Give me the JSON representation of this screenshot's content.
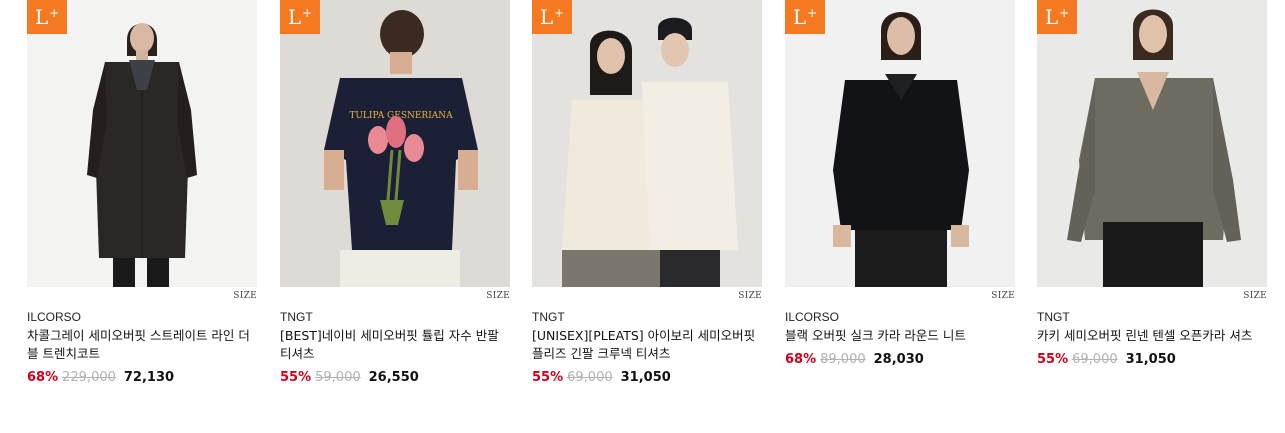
{
  "products": [
    {
      "badge_main": "L",
      "badge_sup": "+",
      "image_icon": "model-photo-long-trench-coat",
      "size_label": "SIZE",
      "brand": "ILCORSO",
      "name": "차콜그레이 세미오버핏 스트레이트 라인 더블 트렌치코트",
      "discount": "68%",
      "original_price": "229,000",
      "sale_price": "72,130",
      "colors": {
        "bg": "#f3f3f1",
        "garment": "#2b2724",
        "inner": "#3c4148",
        "pants": "#1a1a1a"
      }
    },
    {
      "badge_main": "L",
      "badge_sup": "+",
      "image_icon": "model-photo-tshirt-back-tulip-print",
      "size_label": "SIZE",
      "brand": "TNGT",
      "name": "[BEST]네이비 세미오버핏 튤립 자수 반팔 티셔츠",
      "discount": "55%",
      "original_price": "59,000",
      "sale_price": "26,550",
      "colors": {
        "bg": "#dedad6",
        "garment": "#1b2036",
        "print": "#e9b23c",
        "flower": "#e98b95",
        "pants": "#efece3"
      }
    },
    {
      "badge_main": "L",
      "badge_sup": "+",
      "image_icon": "two-models-ivory-longsleeve",
      "size_label": "SIZE",
      "brand": "TNGT",
      "name": "[UNISEX][PLEATS] 아이보리 세미오버핏 플리즈 긴팔 크루넥 티셔츠",
      "discount": "55%",
      "original_price": "69,000",
      "sale_price": "31,050",
      "colors": {
        "bg": "#e4e2de",
        "garment": "#efeadc",
        "hat": "#1c1c20",
        "pants": "#7b776c"
      }
    },
    {
      "badge_main": "L",
      "badge_sup": "+",
      "image_icon": "model-photo-black-collar-knit",
      "size_label": "SIZE",
      "brand": "ILCORSO",
      "name": "블랙 오버핏 실크 카라 라운드 니트",
      "discount": "68%",
      "original_price": "89,000",
      "sale_price": "28,030",
      "colors": {
        "bg": "#f1f1f1",
        "garment": "#121316",
        "pants": "#1b1b1c"
      }
    },
    {
      "badge_main": "L",
      "badge_sup": "+",
      "image_icon": "model-photo-khaki-open-collar-shirt",
      "size_label": "SIZE",
      "brand": "TNGT",
      "name": "카키 세미오버핏 린넨 텐셀 오픈카라 셔츠",
      "discount": "55%",
      "original_price": "69,000",
      "sale_price": "31,050",
      "colors": {
        "bg": "#e9e9e7",
        "garment": "#6e6c60",
        "pants": "#1a1a1a"
      }
    }
  ],
  "accent": "#f47920",
  "discount_color": "#d0021b"
}
